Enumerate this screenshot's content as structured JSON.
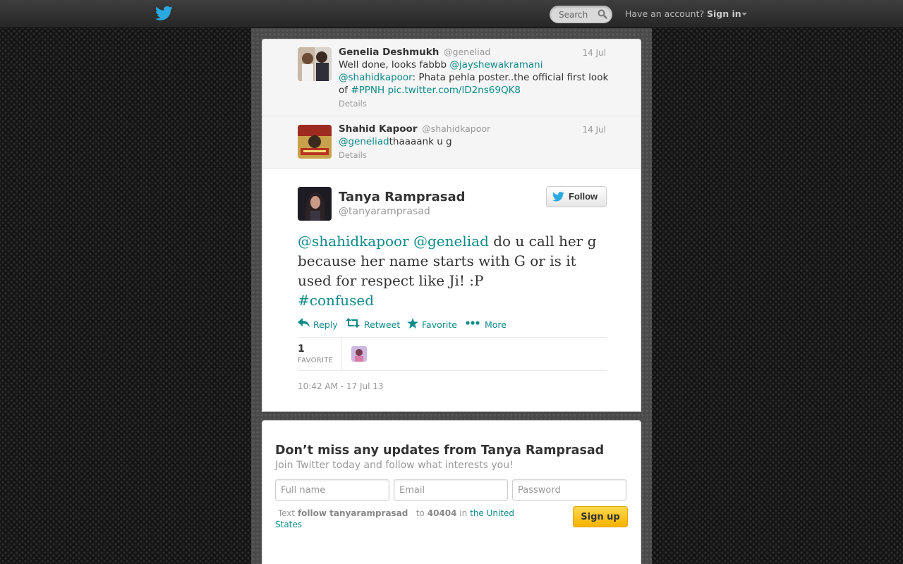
{
  "colors": {
    "link": "#0f8a8a",
    "signup_button": "#f5b200",
    "topbar": "#333333"
  },
  "topbar": {
    "logo_icon": "twitter-bird-icon",
    "search_placeholder": "Search",
    "have_account": "Have an account?",
    "sign_in": "Sign in"
  },
  "replies": [
    {
      "name": "Genelia Deshmukh",
      "handle": "@geneliad",
      "date": "14 Jul",
      "text_plain_1": "Well done, looks fabbb ",
      "mention_1": "@jayshewakramani",
      "mention_2": "@shahidkapoor",
      "text_plain_2": ": Phata pehla poster..the official first look of ",
      "hashtag": "#PPNH",
      "pic_link": "pic.twitter.com/lD2ns69QK8",
      "details": "Details"
    },
    {
      "name": "Shahid Kapoor",
      "handle": "@shahidkapoor",
      "date": "14 Jul",
      "mention": "@geneliad",
      "text_plain": "thaaaank u g",
      "details": "Details"
    }
  ],
  "tweet": {
    "name": "Tanya Ramprasad",
    "handle": "@tanyaramprasad",
    "follow_label": "Follow",
    "mention_1": "@shahidkapoor",
    "mention_2": "@geneliad",
    "text": " do u call her g because her name starts with G or is it used for respect like Ji! :P",
    "hashtag": "#confused",
    "actions": {
      "reply": "Reply",
      "retweet": "Retweet",
      "favorite": "Favorite",
      "more": "More"
    },
    "favorite_count": "1",
    "favorite_label": "FAVORITE",
    "timestamp": "10:42 AM - 17 Jul 13"
  },
  "signup": {
    "title": "Don’t miss any updates from Tanya Ramprasad",
    "subtitle": "Join Twitter today and follow what interests you!",
    "fullname_placeholder": "Full name",
    "email_placeholder": "Email",
    "password_placeholder": "Password",
    "sms_text_label": "Text",
    "sms_command": "follow tanyaramprasad",
    "sms_to": "to",
    "sms_number": "40404",
    "sms_in": "in",
    "sms_country": "the United States",
    "button": "Sign up"
  }
}
